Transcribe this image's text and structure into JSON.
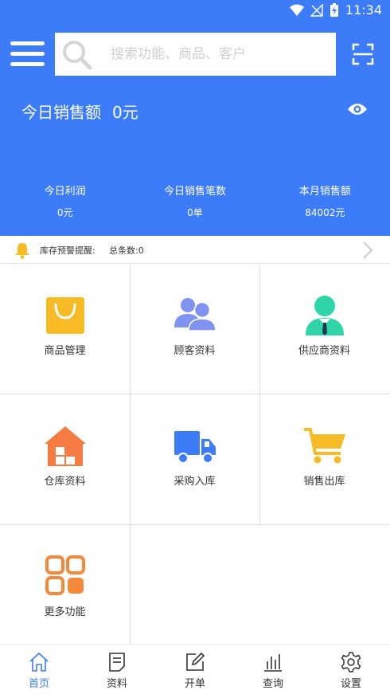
{
  "status_bar": {
    "time": "11:34"
  },
  "search": {
    "placeholder": "搜索功能、商品、客户"
  },
  "summary": {
    "label": "今日销售额",
    "value": "0元"
  },
  "stats": [
    {
      "label": "今日利润",
      "value": "0元"
    },
    {
      "label": "今日销售笔数",
      "value": "0单"
    },
    {
      "label": "本月销售额",
      "value": "84002元"
    }
  ],
  "alert": {
    "label": "库存预警提醒:",
    "count_text": "总条数:0"
  },
  "grid": [
    {
      "label": "商品管理",
      "icon": "shopping-bag-icon",
      "color": "#f6bb25"
    },
    {
      "label": "顾客资料",
      "icon": "customers-icon",
      "color": "#8093f0"
    },
    {
      "label": "供应商资料",
      "icon": "supplier-icon",
      "color": "#2fd5a9"
    },
    {
      "label": "仓库资料",
      "icon": "warehouse-icon",
      "color": "#f47b41"
    },
    {
      "label": "采购入库",
      "icon": "truck-icon",
      "color": "#3d7cf9"
    },
    {
      "label": "销售出库",
      "icon": "cart-icon",
      "color": "#f6bb25"
    },
    {
      "label": "更多功能",
      "icon": "more-grid-icon",
      "color": "#f6883a"
    }
  ],
  "bottom_nav": [
    {
      "label": "首页",
      "icon": "home-icon",
      "active": true
    },
    {
      "label": "资料",
      "icon": "document-icon",
      "active": false
    },
    {
      "label": "开单",
      "icon": "edit-icon",
      "active": false
    },
    {
      "label": "查询",
      "icon": "bar-chart-icon",
      "active": false
    },
    {
      "label": "设置",
      "icon": "gear-icon",
      "active": false
    }
  ],
  "colors": {
    "primary": "#3d7cf9",
    "alert_bell": "#f6bb25"
  }
}
